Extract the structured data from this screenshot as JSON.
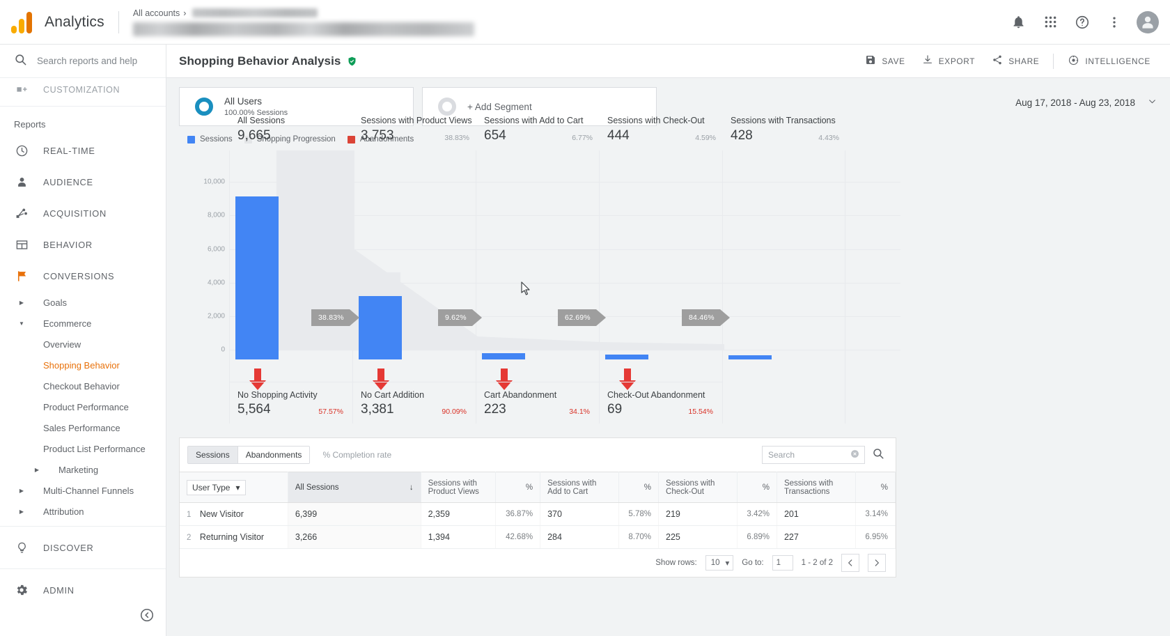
{
  "topbar": {
    "brand": "Analytics",
    "breadcrumb_all_accounts": "All accounts",
    "breadcrumb_sep": "›",
    "icons": {
      "notifications": "bell-icon",
      "apps": "apps-grid-icon",
      "help": "help-icon",
      "more": "more-vert-icon",
      "avatar": "user-avatar"
    }
  },
  "sidebar": {
    "search_placeholder": "Search reports and help",
    "customization_label": "CUSTOMIZATION",
    "reports_label": "Reports",
    "sections": [
      {
        "label": "REAL-TIME",
        "icon": "clock-icon"
      },
      {
        "label": "AUDIENCE",
        "icon": "person-icon"
      },
      {
        "label": "ACQUISITION",
        "icon": "acquisition-icon"
      },
      {
        "label": "BEHAVIOR",
        "icon": "behavior-icon"
      },
      {
        "label": "CONVERSIONS",
        "icon": "flag-icon"
      }
    ],
    "conversions_children": [
      {
        "label": "Goals",
        "expandable": true,
        "expanded": false
      },
      {
        "label": "Ecommerce",
        "expandable": true,
        "expanded": true
      }
    ],
    "ecommerce_children": [
      {
        "label": "Overview",
        "selected": false
      },
      {
        "label": "Shopping Behavior",
        "selected": true
      },
      {
        "label": "Checkout Behavior",
        "selected": false
      },
      {
        "label": "Product Performance",
        "selected": false
      },
      {
        "label": "Sales Performance",
        "selected": false
      },
      {
        "label": "Product List Performance",
        "selected": false
      },
      {
        "label": "Marketing",
        "selected": false,
        "expandable": true
      }
    ],
    "conversions_tail": [
      {
        "label": "Multi-Channel Funnels",
        "expandable": true
      },
      {
        "label": "Attribution",
        "expandable": true
      }
    ],
    "bottom": [
      {
        "label": "DISCOVER",
        "icon": "lightbulb-icon"
      },
      {
        "label": "ADMIN",
        "icon": "gear-icon"
      }
    ],
    "collapse_icon": "chevron-left-icon"
  },
  "header": {
    "title": "Shopping Behavior Analysis",
    "verified_icon": "verified-shield-icon",
    "actions": [
      {
        "label": "SAVE",
        "icon": "save-icon"
      },
      {
        "label": "EXPORT",
        "icon": "download-icon"
      },
      {
        "label": "SHARE",
        "icon": "share-icon"
      },
      {
        "label": "INTELLIGENCE",
        "icon": "intelligence-icon"
      }
    ]
  },
  "segments": {
    "all_users_title": "All Users",
    "all_users_sub": "100.00% Sessions",
    "add_segment_label": "+ Add Segment"
  },
  "date_range": {
    "value": "Aug 17, 2018 - Aug 23, 2018",
    "caret_icon": "chevron-down-icon"
  },
  "legend": [
    {
      "label": "Sessions",
      "color": "#4285f4"
    },
    {
      "label": "Shopping Progression",
      "color": "#e8eaed"
    },
    {
      "label": "Abandonments",
      "color": "#db4437"
    }
  ],
  "chart_data": {
    "type": "bar",
    "title": "Shopping Behavior Analysis",
    "xlabel": "",
    "ylabel": "Sessions",
    "ylim": [
      0,
      10000
    ],
    "grid": true,
    "legend_position": "top-left",
    "y_ticks": [
      "10,000",
      "8,000",
      "6,000",
      "4,000",
      "2,000",
      "0"
    ],
    "y_tick_values": [
      10000,
      8000,
      6000,
      4000,
      2000,
      0
    ],
    "categories": [
      "All Sessions",
      "Sessions with Product Views",
      "Sessions with Add to Cart",
      "Sessions with Check-Out",
      "Sessions with Transactions"
    ],
    "values": [
      9665,
      3753,
      654,
      444,
      428
    ],
    "value_labels": [
      "9,665",
      "3,753",
      "654",
      "444",
      "428"
    ],
    "percent_labels": [
      "",
      "38.83%",
      "6.77%",
      "4.59%",
      "4.43%"
    ],
    "progression_rates": [
      "38.83%",
      "9.62%",
      "62.69%",
      "84.46%"
    ],
    "abandonment_categories": [
      "No Shopping Activity",
      "No Cart Addition",
      "Cart Abandonment",
      "Check-Out Abandonment"
    ],
    "abandonment_values": [
      5564,
      3381,
      223,
      69
    ],
    "abandonment_value_labels": [
      "5,564",
      "3,381",
      "223",
      "69"
    ],
    "abandonment_percent_labels": [
      "57.57%",
      "90.09%",
      "34.1%",
      "15.54%"
    ]
  },
  "table": {
    "tabs": [
      {
        "label": "Sessions",
        "active": true
      },
      {
        "label": "Abandonments",
        "active": false
      }
    ],
    "completion_rate_label": "% Completion rate",
    "search_placeholder": "Search",
    "clear_icon": "clear-circle-icon",
    "search_icon": "search-icon",
    "dimension_selector": "User Type",
    "dimension_caret": "chevron-down-icon",
    "sort_icon": "arrow-down-icon",
    "columns": [
      "All Sessions",
      "Sessions with Product Views",
      "%",
      "Sessions with Add to Cart",
      "%",
      "Sessions with Check-Out",
      "%",
      "Sessions with Transactions",
      "%"
    ],
    "rows": [
      {
        "index": "1",
        "name": "New Visitor",
        "all_sessions": "6,399",
        "product_views": "2,359",
        "product_views_pct": "36.87%",
        "add_to_cart": "370",
        "add_to_cart_pct": "5.78%",
        "check_out": "219",
        "check_out_pct": "3.42%",
        "transactions": "201",
        "transactions_pct": "3.14%"
      },
      {
        "index": "2",
        "name": "Returning Visitor",
        "all_sessions": "3,266",
        "product_views": "1,394",
        "product_views_pct": "42.68%",
        "add_to_cart": "284",
        "add_to_cart_pct": "8.70%",
        "check_out": "225",
        "check_out_pct": "6.89%",
        "transactions": "227",
        "transactions_pct": "6.95%"
      }
    ],
    "footer": {
      "show_rows_label": "Show rows:",
      "show_rows_value": "10",
      "goto_label": "Go to:",
      "goto_value": "1",
      "range_label": "1 - 2 of 2",
      "prev_icon": "chevron-left-icon",
      "next_icon": "chevron-right-icon"
    }
  }
}
